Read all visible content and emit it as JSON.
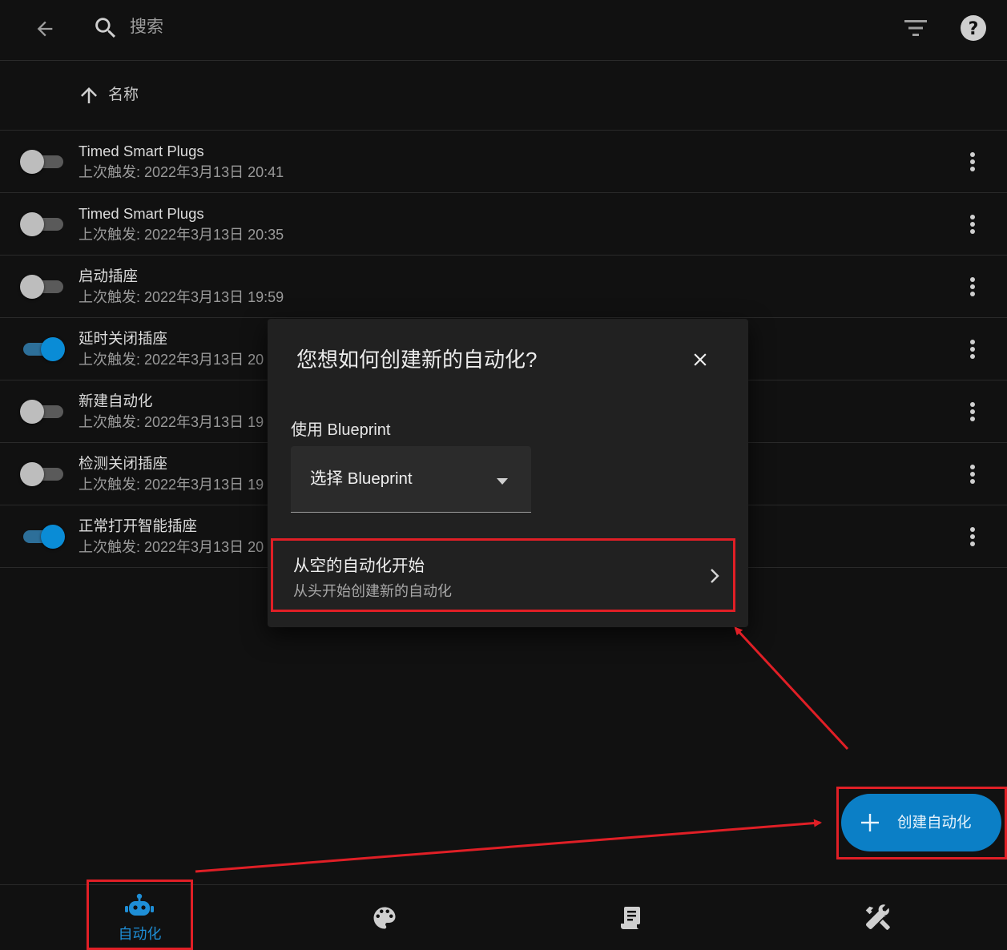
{
  "toolbar": {
    "back_icon": "arrow-left-icon",
    "search_placeholder": "搜索",
    "filter_icon": "filter-icon",
    "help_icon": "help-circle-icon"
  },
  "table": {
    "sort_column_label": "名称",
    "sort_direction": "ascending",
    "rows": [
      {
        "name": "Timed Smart Plugs",
        "last_triggered": "上次触发: 2022年3月13日 20:41",
        "enabled": false
      },
      {
        "name": "Timed Smart Plugs",
        "last_triggered": "上次触发: 2022年3月13日 20:35",
        "enabled": false
      },
      {
        "name": "启动插座",
        "last_triggered": "上次触发: 2022年3月13日 19:59",
        "enabled": false
      },
      {
        "name": "延时关闭插座",
        "last_triggered": "上次触发: 2022年3月13日 20",
        "enabled": true
      },
      {
        "name": "新建自动化",
        "last_triggered": "上次触发: 2022年3月13日 19",
        "enabled": false
      },
      {
        "name": "检测关闭插座",
        "last_triggered": "上次触发: 2022年3月13日 19",
        "enabled": false
      },
      {
        "name": "正常打开智能插座",
        "last_triggered": "上次触发: 2022年3月13日 20",
        "enabled": true
      }
    ]
  },
  "dialog": {
    "title": "您想如何创建新的自动化?",
    "blueprint_label": "使用 Blueprint",
    "blueprint_select_value": "选择 Blueprint",
    "empty_title": "从空的自动化开始",
    "empty_subtitle": "从头开始创建新的自动化"
  },
  "fab": {
    "label": "创建自动化"
  },
  "bottom_nav": {
    "items": [
      {
        "label": "自动化",
        "icon": "robot-icon",
        "active": true
      },
      {
        "label": "",
        "icon": "palette-icon",
        "active": false
      },
      {
        "label": "",
        "icon": "script-icon",
        "active": false
      },
      {
        "label": "",
        "icon": "tools-icon",
        "active": false
      }
    ]
  },
  "colors": {
    "background": "#111111",
    "accent": "#0b7fc6",
    "highlight_border": "#e01f26",
    "dialog_bg": "#212121"
  }
}
